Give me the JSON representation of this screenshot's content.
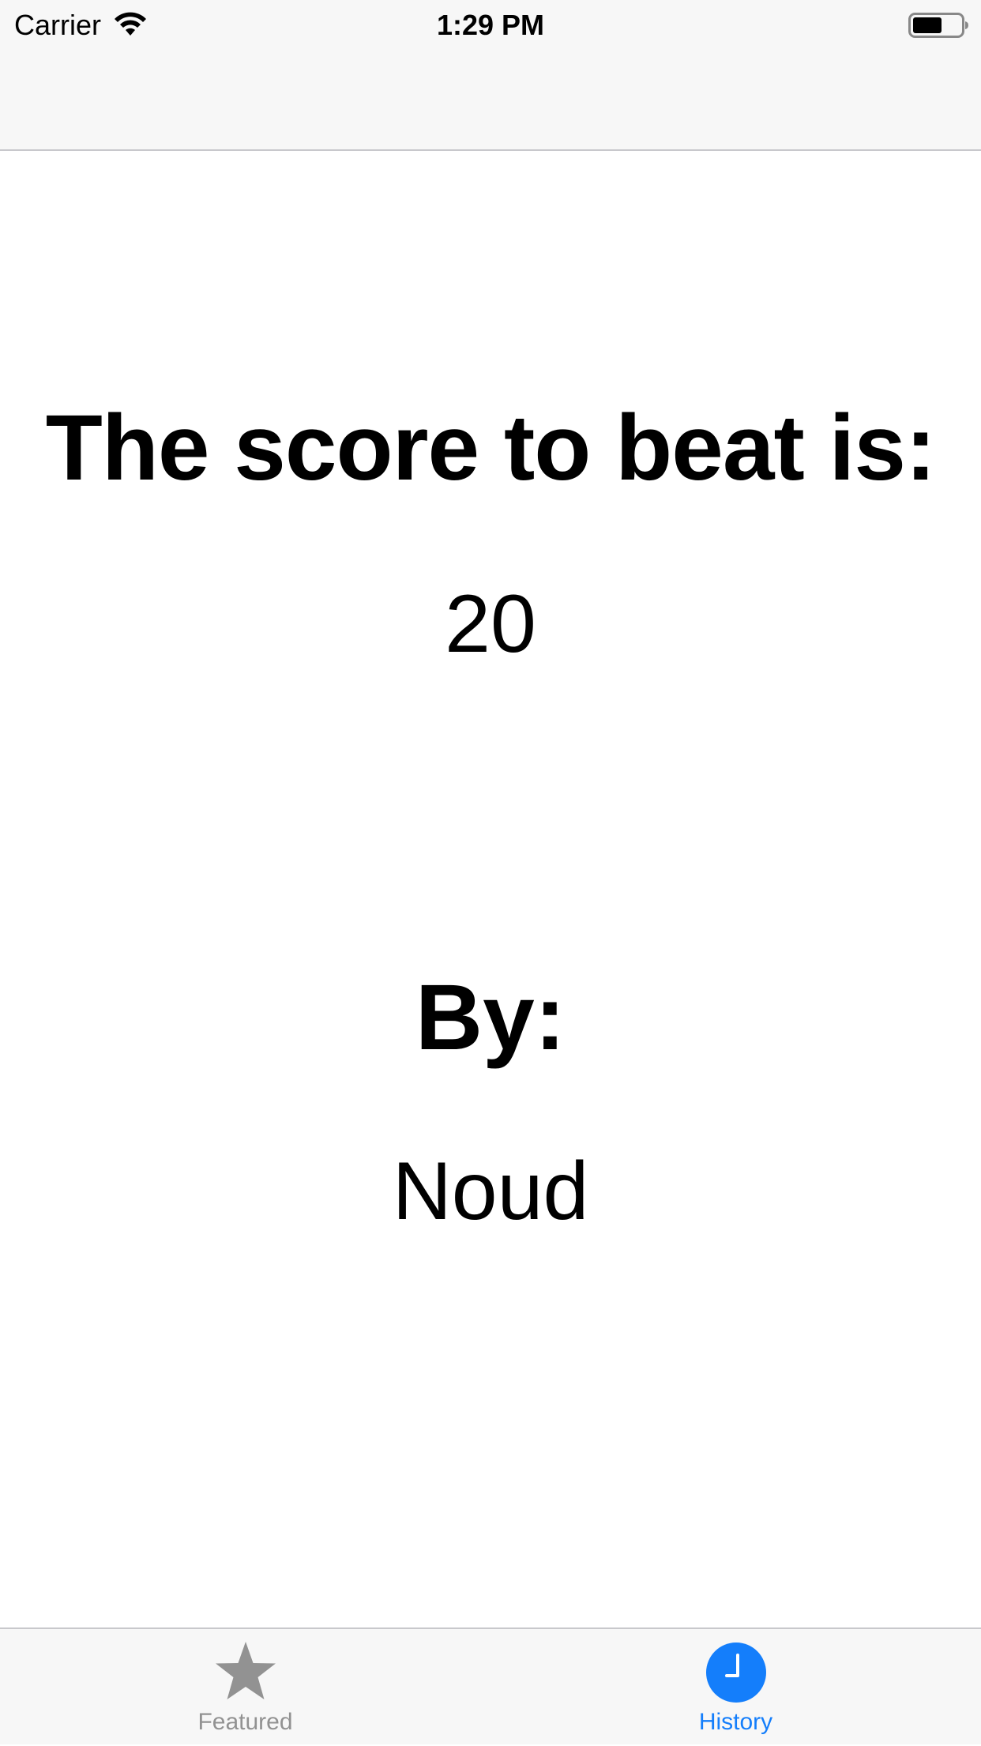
{
  "status_bar": {
    "carrier": "Carrier",
    "time": "1:29 PM",
    "wifi_icon": "wifi-icon",
    "battery_icon": "battery-icon"
  },
  "main": {
    "score_heading": "The score to beat is:",
    "score_value": "20",
    "by_heading": "By:",
    "by_name": "Noud"
  },
  "tab_bar": {
    "items": [
      {
        "label": "Featured",
        "icon": "star-icon",
        "selected": false
      },
      {
        "label": "History",
        "icon": "clock-icon",
        "selected": true
      }
    ]
  },
  "colors": {
    "accent": "#147efb",
    "inactive": "#929292",
    "bar_background": "#f7f7f7",
    "separator": "#c8c8cc"
  }
}
